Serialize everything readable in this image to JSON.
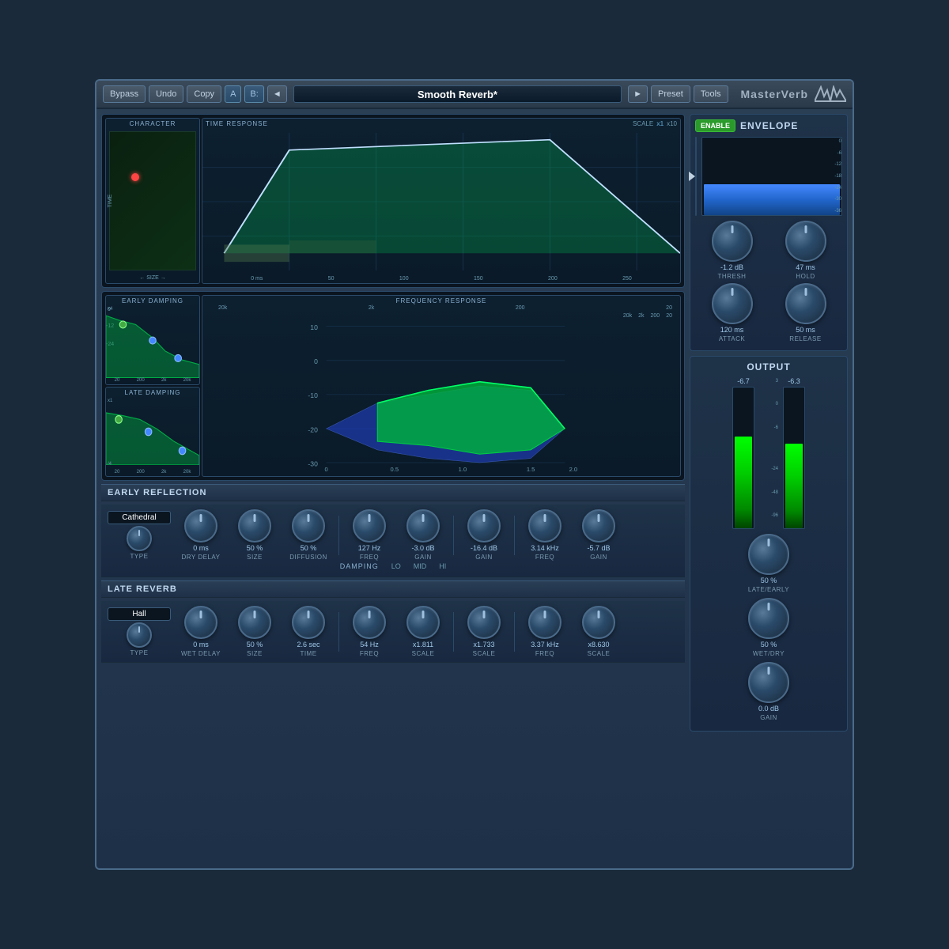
{
  "app": {
    "title": "MasterVerb"
  },
  "topbar": {
    "bypass_label": "Bypass",
    "undo_label": "Undo",
    "copy_label": "Copy",
    "ab_label": "A",
    "b_label": "B:",
    "nav_prev": "◄",
    "preset_name": "Smooth Reverb*",
    "nav_next": "►",
    "preset_label": "Preset",
    "tools_label": "Tools",
    "brand": "MasterVerb"
  },
  "envelope": {
    "enable_label": "ENABLE",
    "title": "ENVELOPE",
    "thresh_value": "-1.2 dB",
    "thresh_label": "THRESH",
    "hold_value": "47 ms",
    "hold_label": "HOLD",
    "attack_value": "120 ms",
    "attack_label": "ATTACK",
    "release_value": "50 ms",
    "release_label": "RELEASE",
    "meter_labels": [
      "0",
      "-6",
      "-12",
      "-18",
      "-24",
      "-30",
      "-36"
    ]
  },
  "output": {
    "title": "OUTPUT",
    "left_value": "-6.7",
    "right_value": "-6.3",
    "scale_labels": [
      "3",
      "0",
      "-6",
      "-24",
      "-48",
      "-96"
    ],
    "late_early_value": "50 %",
    "late_early_label": "LATE/EARLY",
    "wet_dry_value": "50 %",
    "wet_dry_label": "WET/DRY",
    "gain_value": "0.0 dB",
    "gain_label": "GAIN"
  },
  "early_reflection": {
    "section_label": "EARLY REFLECTION",
    "type_value": "Cathedral",
    "type_label": "TYPE",
    "dry_delay_value": "0 ms",
    "dry_delay_label": "DRY DELAY",
    "size_value": "50 %",
    "size_label": "SIZE",
    "diffusion_value": "50 %",
    "diffusion_label": "DIFFUSION",
    "lo_freq_value": "127 Hz",
    "lo_freq_label": "FREQ",
    "lo_gain_value": "-3.0 dB",
    "lo_gain_label": "GAIN",
    "mid_gain_value": "-16.4 dB",
    "mid_gain_label": "GAIN",
    "hi_freq_value": "3.14 kHz",
    "hi_freq_label": "FREQ",
    "hi_gain_value": "-5.7 dB",
    "hi_gain_label": "GAIN",
    "damping_label": "DAMPING",
    "lo_label": "LO",
    "mid_label": "MID",
    "hi_label": "HI"
  },
  "late_reverb": {
    "section_label": "LATE REVERB",
    "type_value": "Hall",
    "type_label": "TYPE",
    "wet_delay_value": "0 ms",
    "wet_delay_label": "WET DELAY",
    "size_value": "50 %",
    "size_label": "SIZE",
    "time_value": "2.6 sec",
    "time_label": "TIME",
    "lo_freq_value": "54 Hz",
    "lo_freq_label": "FREQ",
    "lo_scale_value": "x1.811",
    "lo_scale_label": "SCALE",
    "mid_scale_value": "x1.733",
    "mid_scale_label": "SCALE",
    "hi_freq_value": "3.37 kHz",
    "hi_freq_label": "FREQ",
    "hi_scale_value": "x8.630",
    "hi_scale_label": "SCALE"
  },
  "character": {
    "label": "CHARACTER",
    "time_label": "TIME",
    "size_label": "SIZE"
  },
  "time_response": {
    "label": "TIME RESPONSE",
    "scale_label": "SCALE",
    "scale_x1": "x1",
    "scale_x10": "x10",
    "axis_labels": [
      "0 ms",
      "50",
      "100",
      "150",
      "200",
      "250"
    ]
  },
  "early_damping": {
    "label": "EARLY DAMPING",
    "axis_labels": [
      "20",
      "200",
      "2k",
      "20k"
    ],
    "y_labels": [
      "0",
      "-12",
      "-24"
    ],
    "multiplier": "x4"
  },
  "late_damping": {
    "label": "LATE DAMPING",
    "axis_labels": [
      "20",
      "200",
      "2k",
      "20k"
    ],
    "y_labels": [],
    "multiplier_top": "x1",
    "multiplier_bot": "/4"
  },
  "freq_response": {
    "label": "FREQUENCY RESPONSE",
    "x_labels": [
      "20k",
      "2k",
      "200",
      "20"
    ],
    "y_top_labels": [
      "20k",
      "2k",
      "200",
      "20"
    ]
  }
}
